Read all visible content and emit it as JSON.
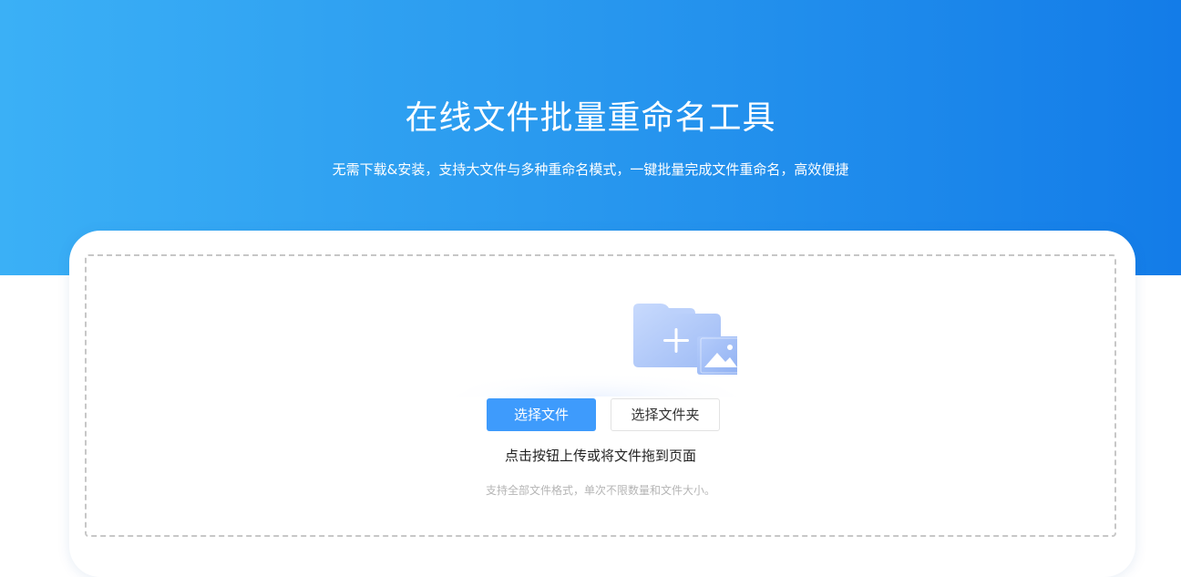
{
  "header": {
    "title": "在线文件批量重命名工具",
    "subtitle": "无需下载&安装，支持大文件与多种重命名模式，一键批量完成文件重命名，高效便捷"
  },
  "upload": {
    "illustration_icon": "folder-add-image-icon",
    "select_file_button": "选择文件",
    "select_folder_button": "选择文件夹",
    "hint": "点击按钮上传或将文件拖到页面",
    "sub_hint": "支持全部文件格式，单次不限数量和文件大小。"
  },
  "colors": {
    "hero_gradient_start": "#3bb0f6",
    "hero_gradient_end": "#137ce8",
    "primary_button": "#3e9bfc"
  }
}
